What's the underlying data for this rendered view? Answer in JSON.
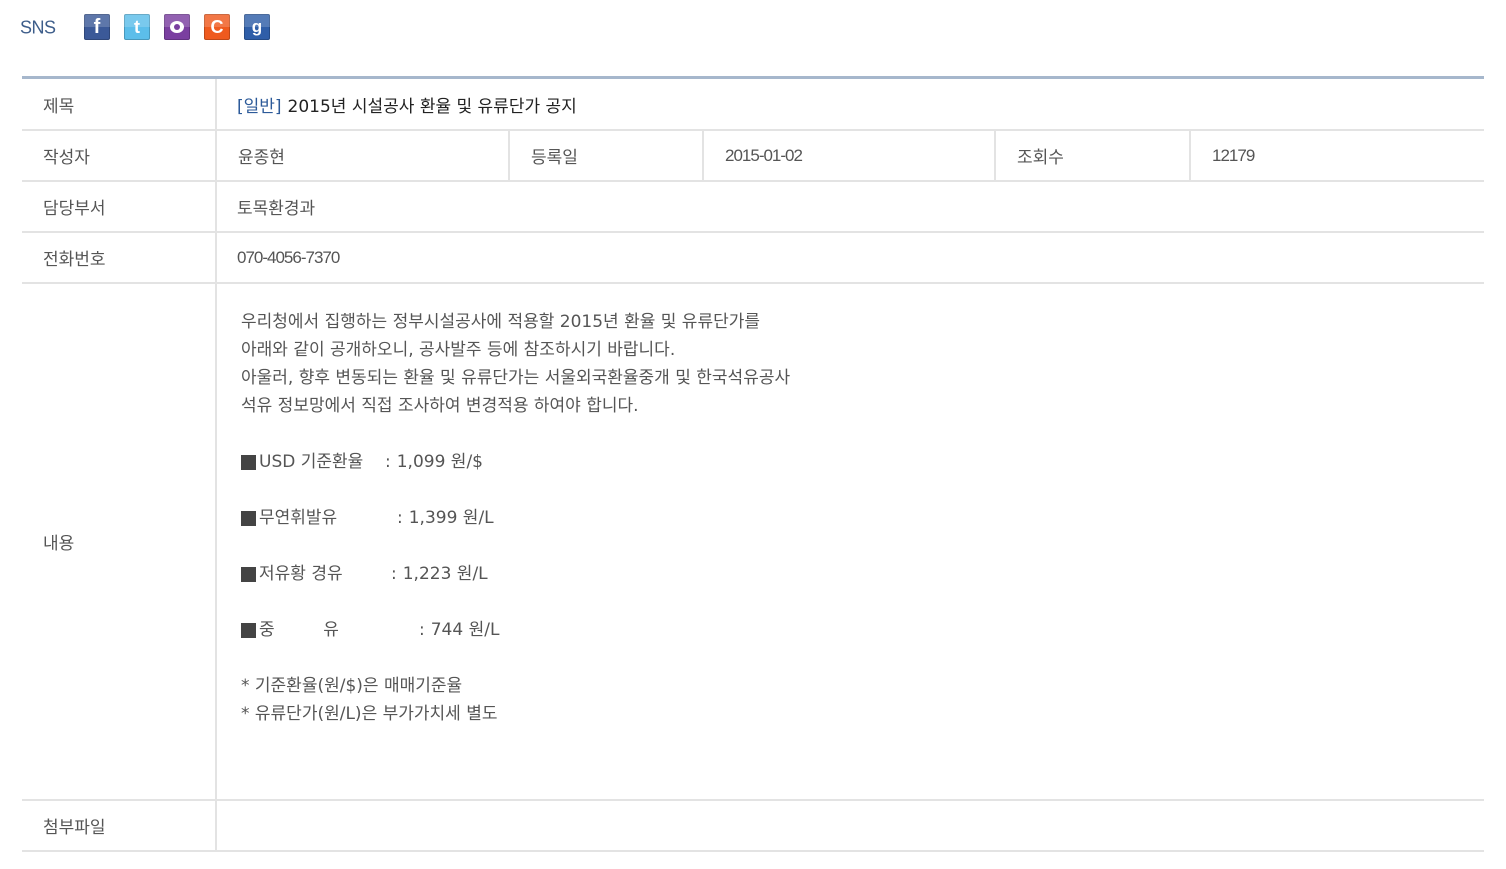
{
  "sns": {
    "label": "SNS",
    "icons": [
      {
        "name": "facebook-icon",
        "glyph": "f",
        "color": "#3b5998"
      },
      {
        "name": "twitter-icon",
        "glyph": "t",
        "color": "#5cbeea"
      },
      {
        "name": "kakaostory-icon",
        "glyph": "",
        "color": "#7a3fa0"
      },
      {
        "name": "cyworld-icon",
        "glyph": "C",
        "color": "#ef5a1e"
      },
      {
        "name": "google-icon",
        "glyph": "g",
        "color": "#2f5ea8"
      }
    ]
  },
  "post": {
    "title_label": "제목",
    "category": "[일반]",
    "title": "2015년 시설공사 환율 및 유류단가 공지",
    "author_label": "작성자",
    "author": "윤종현",
    "date_label": "등록일",
    "date": "2015-01-02",
    "views_label": "조회수",
    "views": "12179",
    "dept_label": "담당부서",
    "dept": "토목환경과",
    "phone_label": "전화번호",
    "phone": "070-4056-7370",
    "content_label": "내용",
    "content": {
      "intro": [
        "우리청에서 집행하는 정부시설공사에 적용할 2015년 환율 및 유류단가를",
        "아래와 같이 공개하오니, 공사발주 등에 참조하시기 바랍니다.",
        "아울러, 향후 변동되는 환율 및 유류단가는 서울외국환율중개 및 한국석유공사",
        "석유 정보망에서 직접 조사하여 변경적용 하여야 합니다."
      ],
      "rates": [
        {
          "name": "USD 기준환율",
          "value": "1,099 원/$"
        },
        {
          "name": "무연휘발유",
          "value": "1,399 원/L"
        },
        {
          "name": "저유황 경유",
          "value": "1,223  원/L"
        },
        {
          "name": "중         유",
          "value": "744 원/L"
        }
      ],
      "notes": [
        "* 기준환율(원/$)은 매매기준율",
        "* 유류단가(원/L)은 부가가치세 별도"
      ]
    },
    "attachment_label": "첨부파일",
    "attachment": ""
  }
}
